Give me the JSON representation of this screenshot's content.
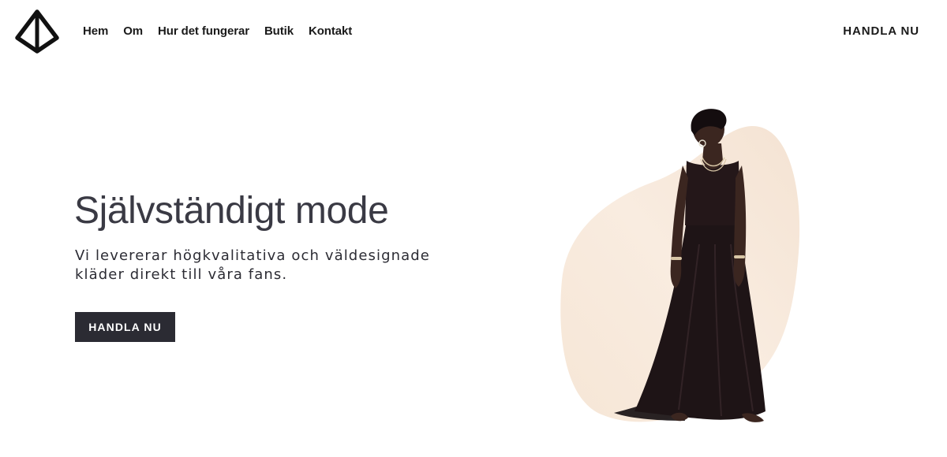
{
  "header": {
    "logo_icon": "diamond-logo-icon",
    "nav": [
      {
        "label": "Hem"
      },
      {
        "label": "Om"
      },
      {
        "label": "Hur det fungerar"
      },
      {
        "label": "Butik"
      },
      {
        "label": "Kontakt"
      }
    ],
    "cta_label": "HANDLA NU"
  },
  "hero": {
    "title": "Självständigt mode",
    "subtitle": "Vi levererar högkvalitativa och väldesignade kläder direkt till våra fans.",
    "cta_label": "HANDLA NU",
    "image_icon": "fashion-model-image"
  },
  "colors": {
    "text_dark": "#1a1a1a",
    "title": "#3a3a44",
    "button_bg": "#2b2b33",
    "blob_light": "#faeee3",
    "blob_dark": "#f2dcc7",
    "dress": "#1e1416",
    "skin": "#3b2620"
  }
}
